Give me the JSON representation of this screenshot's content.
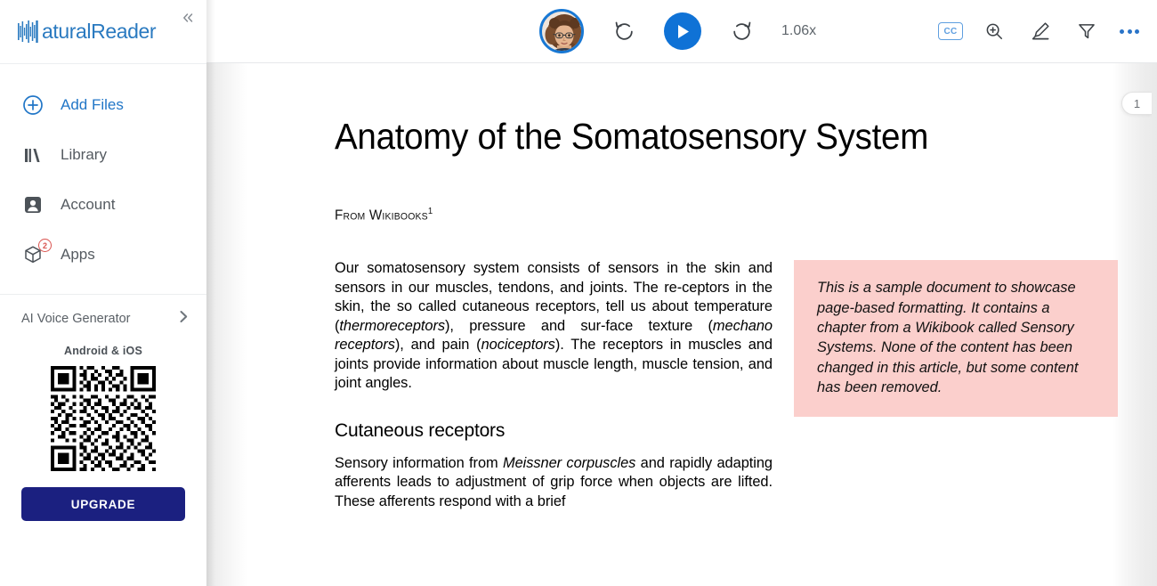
{
  "sidebar": {
    "logo_text": "aturalReader",
    "logo_icon": "waveform-n-logo",
    "collapse_icon": "chevron-double-left-icon",
    "items": [
      {
        "label": "Add Files",
        "icon": "plus-circle-icon",
        "accent": true
      },
      {
        "label": "Library",
        "icon": "books-icon",
        "accent": false
      },
      {
        "label": "Account",
        "icon": "person-card-icon",
        "accent": false
      },
      {
        "label": "Apps",
        "icon": "cube-icon",
        "accent": false,
        "badge": "2"
      }
    ],
    "voice_generator": {
      "label": "AI Voice Generator",
      "chevron": "chevron-right-icon"
    },
    "promo": {
      "title": "Android & iOS",
      "qr_alt": "qr-code",
      "upgrade_label": "UPGRADE"
    }
  },
  "toolbar": {
    "avatar_alt": "voice-avatar",
    "rewind_icon": "rotate-left-icon",
    "play_icon": "play-icon",
    "forward_icon": "rotate-right-icon",
    "speed": "1.06x",
    "cc_label": "CC",
    "zoom_icon": "magnifier-plus-icon",
    "highlighter_icon": "highlighter-pen-icon",
    "filter_icon": "funnel-icon",
    "more_icon": "three-dots-icon"
  },
  "document": {
    "page_tab_number": "1",
    "title": "Anatomy of the Somatosensory System",
    "source_line": "From Wikibooks",
    "source_footnote": "1",
    "paragraph_1_parts": [
      "Our somatosensory system consists of sensors in the skin and sensors in our muscles, tendons, and joints. The re-ceptors in the skin, the so called cutaneous receptors, tell us about temperature (",
      "thermoreceptors",
      "), pressure and sur-face texture (",
      "mechano receptors",
      "), and pain (",
      "nociceptors",
      "). The receptors in muscles and joints provide information about muscle length, muscle tension, and joint angles."
    ],
    "section_heading": "Cutaneous receptors",
    "paragraph_2_parts": [
      "Sensory information from ",
      "Meissner corpuscles",
      " and rapidly adapting afferents leads to adjustment of grip force when objects are lifted. These afferents respond with a brief"
    ],
    "callout_text": "This is a sample document to showcase page-based formatting. It contains a chapter from a Wikibook called Sensory Systems. None of the content has been changed in this article, but some content has been removed."
  },
  "colors": {
    "brand_blue": "#2a7ac0",
    "accent_blue": "#2176c7",
    "play_blue": "#0f72d6",
    "upgrade_navy": "#1b2080",
    "callout_pink": "#fbcfcc",
    "badge_red": "#d9534f"
  }
}
